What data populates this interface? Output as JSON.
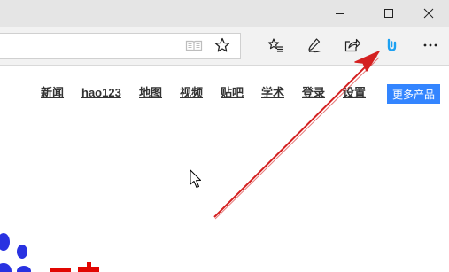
{
  "window": {
    "minimize_icon": "minimize-icon",
    "maximize_icon": "maximize-icon",
    "close_icon": "close-icon"
  },
  "toolbar": {
    "address_value": "",
    "icons": [
      "reading-view-icon",
      "favorite-star-icon",
      "favorites-list-icon",
      "web-note-pen-icon",
      "share-icon",
      "extension-icon",
      "more-ellipsis-icon"
    ]
  },
  "nav": {
    "links": [
      "新闻",
      "hao123",
      "地图",
      "视频",
      "贴吧",
      "学术",
      "登录",
      "设置"
    ],
    "more_button": "更多产品"
  },
  "colors": {
    "titlebar": "#e5e5e5",
    "toolbar": "#f2f2f2",
    "accent_button": "#3385ff",
    "annotation_arrow": "#d42020",
    "logo_blue": "#2932e1",
    "logo_red": "#e10602",
    "extension_icon": "#1da1f2"
  }
}
